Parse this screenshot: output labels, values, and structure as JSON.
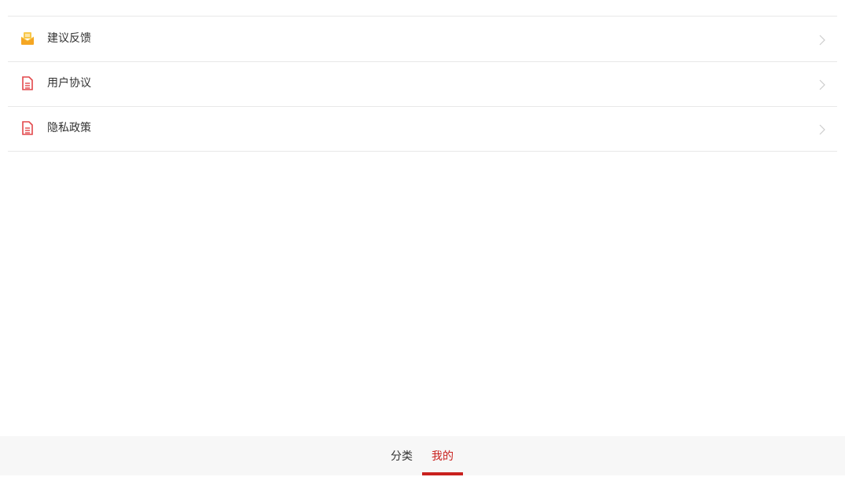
{
  "menu": {
    "items": [
      {
        "label": "建议反馈",
        "icon": "feedback-envelope-icon",
        "icon_color": "#f5b21b"
      },
      {
        "label": "用户协议",
        "icon": "document-icon",
        "icon_color": "#e2474a"
      },
      {
        "label": "隐私政策",
        "icon": "document-icon",
        "icon_color": "#e2474a"
      }
    ]
  },
  "tabbar": {
    "tabs": [
      {
        "label": "分类",
        "active": false
      },
      {
        "label": "我的",
        "active": true
      }
    ],
    "active_color": "#c9211e"
  }
}
